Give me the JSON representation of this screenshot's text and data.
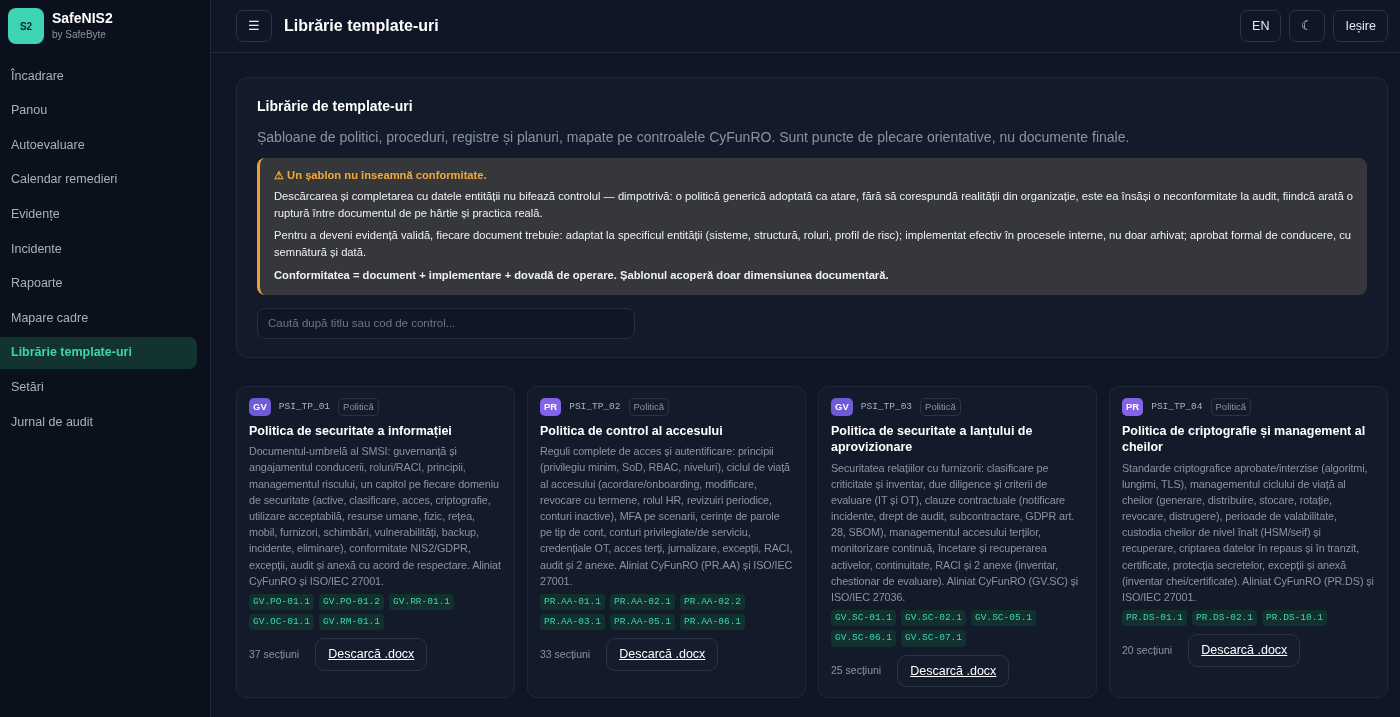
{
  "brand": {
    "logo": "S2",
    "name": "SafeNIS2",
    "tagline": "by SafeByte"
  },
  "sidebar": {
    "items": [
      {
        "label": "Încadrare",
        "selected": false
      },
      {
        "label": "Panou",
        "selected": false
      },
      {
        "label": "Autoevaluare",
        "selected": false
      },
      {
        "label": "Calendar remedieri",
        "selected": false
      },
      {
        "label": "Evidențe",
        "selected": false
      },
      {
        "label": "Incidente",
        "selected": false
      },
      {
        "label": "Rapoarte",
        "selected": false
      },
      {
        "label": "Mapare cadre",
        "selected": false
      },
      {
        "label": "Librărie template-uri",
        "selected": true
      },
      {
        "label": "Setări",
        "selected": false
      },
      {
        "label": "Jurnal de audit",
        "selected": false
      }
    ]
  },
  "header": {
    "menu_button": "☰",
    "title": "Librărie template-uri",
    "buttons": [
      "EN",
      "☾",
      "Ieșire"
    ]
  },
  "panel": {
    "title": "Librărie de template-uri",
    "subtitle": "Șabloane de politici, proceduri, registre și planuri, mapate pe controalele CyFunRO. Sunt puncte de plecare orientative, nu documente finale.",
    "warning": {
      "heading": "⚠ Un șablon nu înseamnă conformitate.",
      "paragraphs": [
        "Descărcarea și completarea cu datele entității nu bifează controlul — dimpotrivă: o politică generică adoptată ca atare, fără să corespundă realității din organizație, este ea însăși o neconformitate la audit, fiindcă arată o ruptură între documentul de pe hârtie și practica reală.",
        "Pentru a deveni evidență validă, fiecare document trebuie: adaptat la specificul entității (sisteme, structură, roluri, profil de risc); implementat efectiv în procesele interne, nu doar arhivat; aprobat formal de conducere, cu semnătură și dată.",
        "**Conformitatea = document + implementare + dovadă de operare. Șablonul acoperă doar dimensiunea documentară.**"
      ]
    },
    "search": {
      "placeholder": "Caută după titlu sau cod de control..."
    }
  },
  "templates": [
    {
      "family": "GV",
      "color": "#6d5bd8",
      "code": "PSI_TP_01",
      "type": "Politică",
      "title": "Politica de securitate a informației",
      "description": "Documentul-umbrelă al SMSI: guvernanță și angajamentul conducerii, roluri/RACI, principii, managementul riscului, un capitol pe fiecare domeniu de securitate (active, clasificare, acces, criptografie, utilizare acceptabilă, resurse umane, fizic, rețea, mobil, furnizori, schimbări, vulnerabilități, backup, incidente, eliminare), conformitate NIS2/GDPR, excepții, audit și anexă cu acord de respectare. Aliniat CyFunRO și ISO/IEC 27001.",
      "controls": [
        "GV.PO-01.1",
        "GV.PO-01.2",
        "GV.RR-01.1",
        "GV.OC-01.1",
        "GV.RM-01.1"
      ],
      "sections": "37 secțiuni",
      "download": "Descarcă .docx"
    },
    {
      "family": "PR",
      "color": "#8563e8",
      "code": "PSI_TP_02",
      "type": "Politică",
      "title": "Politica de control al accesului",
      "description": "Reguli complete de acces și autentificare: principii (privilegiu minim, SoD, RBAC, niveluri), ciclul de viață al accesului (acordare/onboarding, modificare, revocare cu termene, rolul HR, revizuiri periodice, conturi inactive), MFA pe scenarii, cerințe de parole pe tip de cont, conturi privilegiate/de serviciu, credențiale OT, acces terți, jurnalizare, excepții, RACI, audit și 2 anexe. Aliniat CyFunRO (PR.AA) și ISO/IEC 27001.",
      "controls": [
        "PR.AA-01.1",
        "PR.AA-02.1",
        "PR.AA-02.2",
        "PR.AA-03.1",
        "PR.AA-05.1",
        "PR.AA-06.1"
      ],
      "sections": "33 secțiuni",
      "download": "Descarcă .docx"
    },
    {
      "family": "GV",
      "color": "#6d5bd8",
      "code": "PSI_TP_03",
      "type": "Politică",
      "title": "Politica de securitate a lanțului de aprovizionare",
      "description": "Securitatea relațiilor cu furnizorii: clasificare pe criticitate și inventar, due diligence și criterii de evaluare (IT și OT), clauze contractuale (notificare incidente, drept de audit, subcontractare, GDPR art. 28, SBOM), managementul accesului terților, monitorizare continuă, încetare și recuperarea activelor, continuitate, RACI și 2 anexe (inventar, chestionar de evaluare). Aliniat CyFunRO (GV.SC) și ISO/IEC 27036.",
      "controls": [
        "GV.SC-01.1",
        "GV.SC-02.1",
        "GV.SC-05.1",
        "GV.SC-06.1",
        "GV.SC-07.1"
      ],
      "sections": "25 secțiuni",
      "download": "Descarcă .docx"
    },
    {
      "family": "PR",
      "color": "#8563e8",
      "code": "PSI_TP_04",
      "type": "Politică",
      "title": "Politica de criptografie și management al cheilor",
      "description": "Standarde criptografice aprobate/interzise (algoritmi, lungimi, TLS), managementul ciclului de viață al cheilor (generare, distribuire, stocare, rotație, revocare, distrugere), perioade de valabilitate, custodia cheilor de nivel înalt (HSM/seif) și recuperare, criptarea datelor în repaus și în tranzit, certificate, protecția secretelor, excepții și anexă (inventar chei/certificate). Aliniat CyFunRO (PR.DS) și ISO/IEC 27001.",
      "controls": [
        "PR.DS-01.1",
        "PR.DS-02.1",
        "PR.DS-10.1"
      ],
      "sections": "20 secțiuni",
      "download": "Descarcă .docx"
    }
  ]
}
